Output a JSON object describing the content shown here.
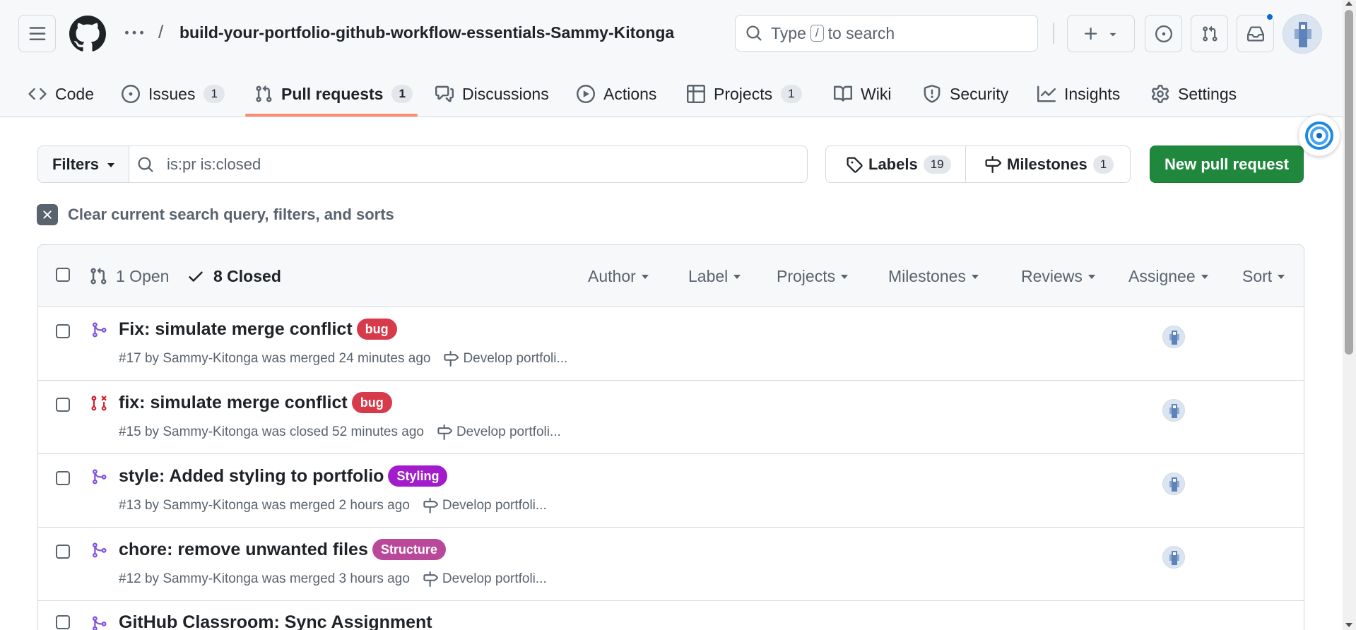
{
  "header": {
    "repo_name": "build-your-portfolio-github-workflow-essentials-Sammy-Kitonga",
    "separator": "/",
    "search": {
      "prefix": "Type",
      "key": "/",
      "suffix": "to search"
    },
    "notification_dot": true
  },
  "tabs": [
    {
      "label": "Code",
      "icon": "code-icon"
    },
    {
      "label": "Issues",
      "count": "1",
      "icon": "issue-opened-icon"
    },
    {
      "label": "Pull requests",
      "count": "1",
      "icon": "git-pull-request-icon",
      "active": true
    },
    {
      "label": "Discussions",
      "icon": "comment-discussion-icon"
    },
    {
      "label": "Actions",
      "icon": "play-icon"
    },
    {
      "label": "Projects",
      "count": "1",
      "icon": "table-icon"
    },
    {
      "label": "Wiki",
      "icon": "book-icon"
    },
    {
      "label": "Security",
      "icon": "shield-icon"
    },
    {
      "label": "Insights",
      "icon": "graph-icon"
    },
    {
      "label": "Settings",
      "icon": "gear-icon"
    }
  ],
  "controls": {
    "filters_label": "Filters",
    "query": "is:pr is:closed",
    "labels_label": "Labels",
    "labels_count": "19",
    "milestones_label": "Milestones",
    "milestones_count": "1",
    "new_pr_label": "New pull request",
    "clear_label": "Clear current search query, filters, and sorts"
  },
  "list_header": {
    "open_label": "1 Open",
    "closed_label": "8 Closed",
    "filters": [
      "Author",
      "Label",
      "Projects",
      "Milestones",
      "Reviews",
      "Assignee",
      "Sort"
    ]
  },
  "pull_requests": [
    {
      "title": "Fix: simulate merge conflict",
      "label": "bug",
      "label_color": "#d73a4a",
      "status": "merged",
      "meta": "#17 by Sammy-Kitonga was merged 24 minutes ago",
      "milestone": "Develop portfoli..."
    },
    {
      "title": "fix: simulate merge conflict",
      "label": "bug",
      "label_color": "#d73a4a",
      "status": "closed",
      "meta": "#15 by Sammy-Kitonga was closed 52 minutes ago",
      "milestone": "Develop portfoli..."
    },
    {
      "title": "style: Added styling to portfolio",
      "label": "Styling",
      "label_color": "#a31ccc",
      "status": "merged",
      "meta": "#13 by Sammy-Kitonga was merged 2 hours ago",
      "milestone": "Develop portfoli..."
    },
    {
      "title": "chore: remove unwanted files",
      "label": "Structure",
      "label_color": "#b9489a",
      "status": "merged",
      "meta": "#12 by Sammy-Kitonga was merged 3 hours ago",
      "milestone": "Develop portfoli..."
    },
    {
      "title": "GitHub Classroom: Sync Assignment",
      "label": "",
      "status": "merged",
      "meta": "",
      "milestone": ""
    }
  ],
  "colors": {
    "accent_underline": "#fd8c73",
    "primary_button": "#1f883d",
    "merged_icon": "#8250df",
    "closed_icon": "#cf222e"
  }
}
